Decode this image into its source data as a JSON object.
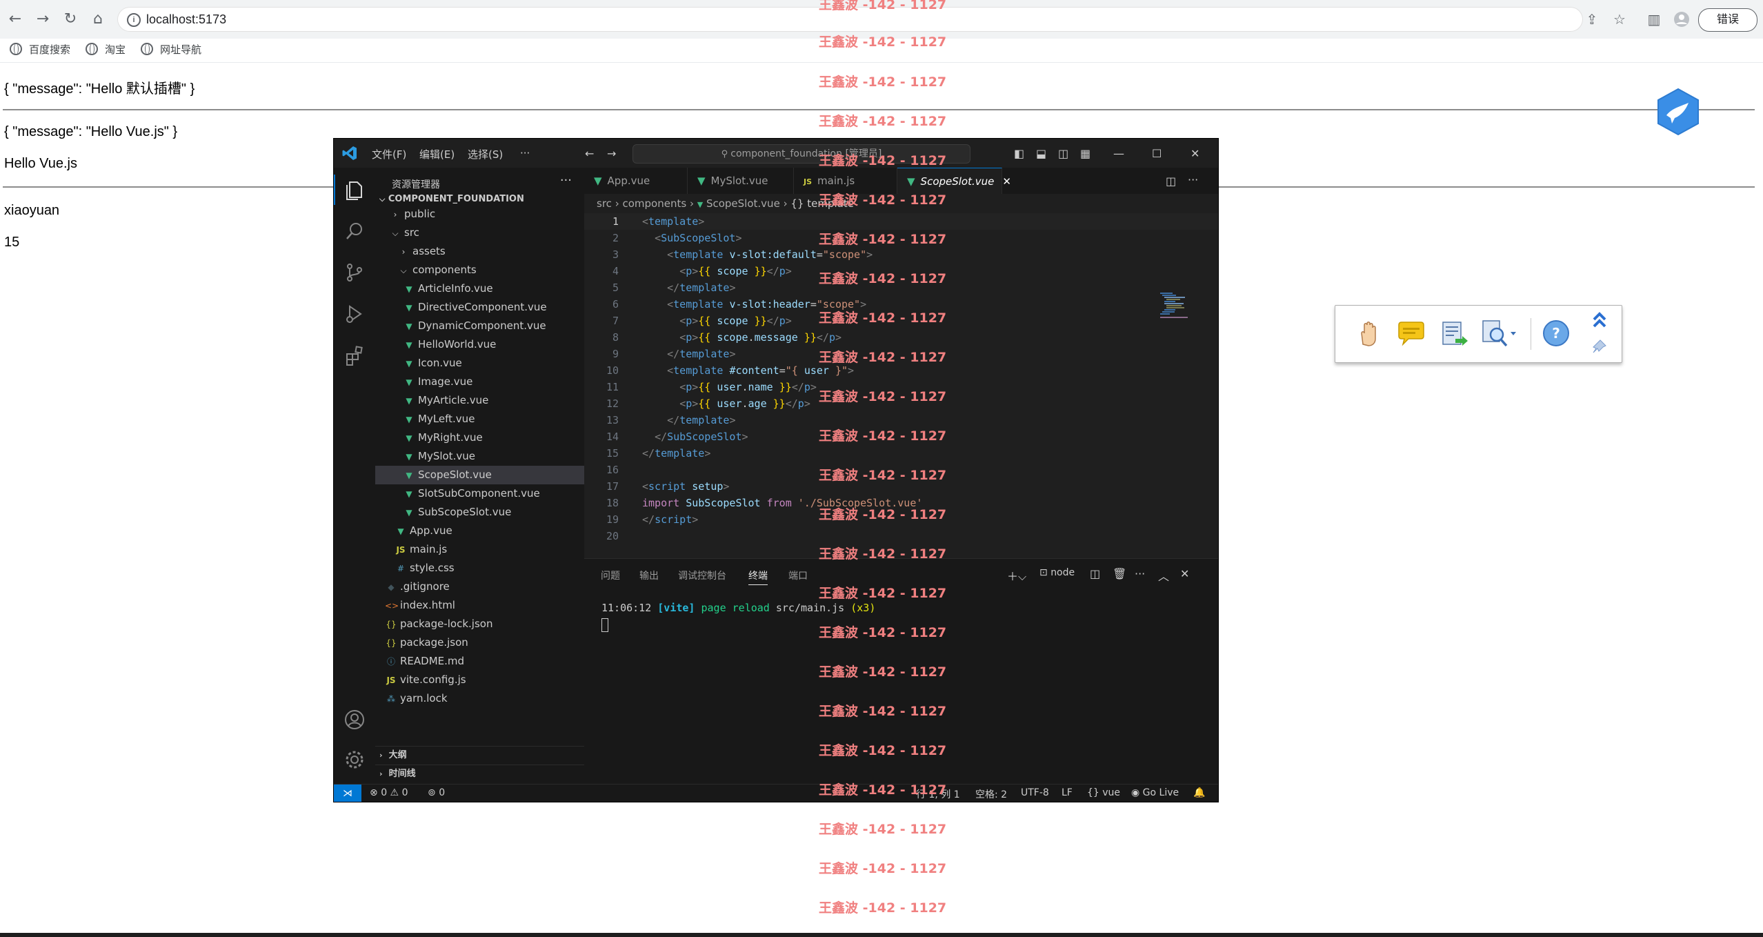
{
  "browser": {
    "url": "localhost:5173",
    "error_button": "错误",
    "bookmarks": [
      "百度搜索",
      "淘宝",
      "网址导航"
    ]
  },
  "page": {
    "line1": "{ \"message\": \"Hello 默认插槽\" }",
    "line2": "{ \"message\": \"Hello Vue.js\" }",
    "line3": "Hello Vue.js",
    "line4": "xiaoyuan",
    "line5": "15"
  },
  "watermark": {
    "text": "王鑫波 -142 - 1127"
  },
  "vscode": {
    "menu": [
      "文件(F)",
      "编辑(E)",
      "选择(S)",
      "···"
    ],
    "search": "component_foundation [管理员]",
    "explorer": {
      "title": "资源管理器",
      "project": "COMPONENT_FOUNDATION",
      "items": [
        {
          "label": "public",
          "type": "folder-closed"
        },
        {
          "label": "src",
          "type": "folder-open"
        },
        {
          "label": "assets",
          "type": "folder-closed"
        },
        {
          "label": "components",
          "type": "folder-open"
        },
        {
          "label": "ArticleInfo.vue",
          "type": "vue"
        },
        {
          "label": "DirectiveComponent.vue",
          "type": "vue"
        },
        {
          "label": "DynamicComponent.vue",
          "type": "vue"
        },
        {
          "label": "HelloWorld.vue",
          "type": "vue"
        },
        {
          "label": "Icon.vue",
          "type": "vue"
        },
        {
          "label": "Image.vue",
          "type": "vue"
        },
        {
          "label": "MyArticle.vue",
          "type": "vue"
        },
        {
          "label": "MyLeft.vue",
          "type": "vue"
        },
        {
          "label": "MyRight.vue",
          "type": "vue"
        },
        {
          "label": "MySlot.vue",
          "type": "vue"
        },
        {
          "label": "ScopeSlot.vue",
          "type": "vue"
        },
        {
          "label": "SlotSubComponent.vue",
          "type": "vue"
        },
        {
          "label": "SubScopeSlot.vue",
          "type": "vue"
        },
        {
          "label": "App.vue",
          "type": "vue"
        },
        {
          "label": "main.js",
          "type": "js"
        },
        {
          "label": "style.css",
          "type": "css"
        },
        {
          "label": ".gitignore",
          "type": "git"
        },
        {
          "label": "index.html",
          "type": "html"
        },
        {
          "label": "package-lock.json",
          "type": "json"
        },
        {
          "label": "package.json",
          "type": "json"
        },
        {
          "label": "README.md",
          "type": "md"
        },
        {
          "label": "vite.config.js",
          "type": "js"
        },
        {
          "label": "yarn.lock",
          "type": "lock"
        }
      ],
      "outline": "大纲",
      "timeline": "时间线"
    },
    "tabs": [
      {
        "label": "App.vue",
        "icon": "vue"
      },
      {
        "label": "MySlot.vue",
        "icon": "vue"
      },
      {
        "label": "main.js",
        "icon": "JS"
      },
      {
        "label": "ScopeSlot.vue",
        "icon": "vue"
      }
    ],
    "breadcrumb": [
      "src",
      "components",
      "ScopeSlot.vue",
      "{} template"
    ],
    "code_lines": [
      "1",
      "2",
      "3",
      "4",
      "5",
      "6",
      "7",
      "8",
      "9",
      "10",
      "11",
      "12",
      "13",
      "14",
      "15",
      "16",
      "17",
      "18",
      "19",
      "20"
    ],
    "panel": {
      "tabs": [
        "问题",
        "输出",
        "调试控制台",
        "终端",
        "端口"
      ],
      "node_label": "node",
      "terminal": {
        "time": "11:06:12",
        "vite": "[vite]",
        "msg": "page reload",
        "file": "src/main.js",
        "count": "(x3)"
      }
    },
    "status": {
      "errors": "0",
      "warnings": "0",
      "ports": "0",
      "position": "行 1, 列 1",
      "spaces": "空格: 2",
      "encoding": "UTF-8",
      "eol": "LF",
      "language": "vue",
      "golive": "Go Live"
    }
  }
}
